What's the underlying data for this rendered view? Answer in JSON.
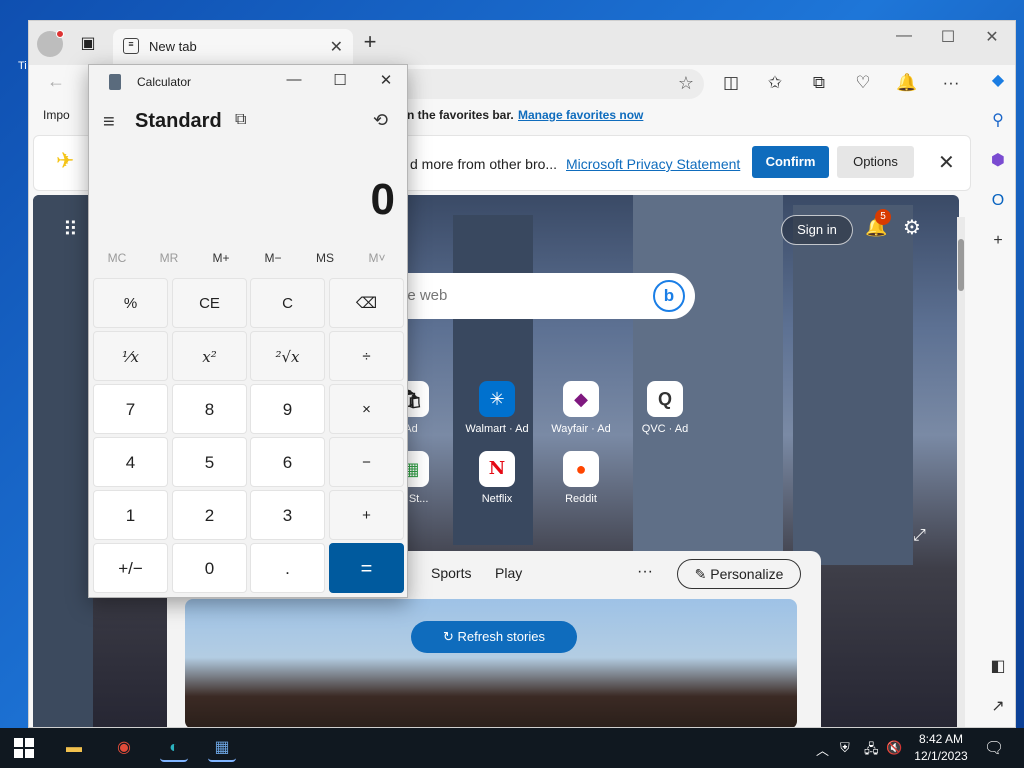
{
  "desktop": {
    "icon_label": "Ti"
  },
  "edge": {
    "tab_title": "New tab",
    "tab_close": "✕",
    "new_tab": "+",
    "window_controls": {
      "minimize": "—",
      "maximize": "☐",
      "close": "✕"
    },
    "favorites_bar": {
      "import_label": "Impo",
      "message": "n the favorites bar.",
      "manage_link": "Manage favorites now"
    },
    "banner": {
      "text": "d more from other bro...",
      "privacy_link": "Microsoft Privacy Statement",
      "confirm": "Confirm",
      "options": "Options",
      "close": "✕"
    },
    "page": {
      "sign_in": "Sign in",
      "notification_count": "5",
      "search_placeholder": "he web",
      "bing_glyph": "b",
      "tiles": [
        {
          "label": "Ad",
          "glyph": "🛍"
        },
        {
          "label": "Walmart · Ad",
          "glyph": "✳"
        },
        {
          "label": "Wayfair · Ad",
          "glyph": "◆"
        },
        {
          "label": "QVC · Ad",
          "glyph": "Q"
        },
        {
          "label": "oft St...",
          "glyph": "▦"
        },
        {
          "label": "Netflix",
          "glyph": "N"
        },
        {
          "label": "Reddit",
          "glyph": "●"
        }
      ],
      "news_nav": [
        "Sports",
        "Play"
      ],
      "more": "···",
      "personalize": "Personalize",
      "refresh_stories": "Refresh stories"
    }
  },
  "calculator": {
    "title": "Calculator",
    "mode": "Standard",
    "display": "0",
    "memory": [
      "MC",
      "MR",
      "M+",
      "M−",
      "MS",
      "M˅"
    ],
    "keys": [
      [
        "%",
        "CE",
        "C",
        "⌫"
      ],
      [
        "¹⁄x",
        "x²",
        "²√x",
        "÷"
      ],
      [
        "7",
        "8",
        "9",
        "×"
      ],
      [
        "4",
        "5",
        "6",
        "−"
      ],
      [
        "1",
        "2",
        "3",
        "+"
      ],
      [
        "+/−",
        "0",
        ".",
        "="
      ]
    ]
  },
  "taskbar": {
    "time": "8:42 AM",
    "date": "12/1/2023"
  }
}
